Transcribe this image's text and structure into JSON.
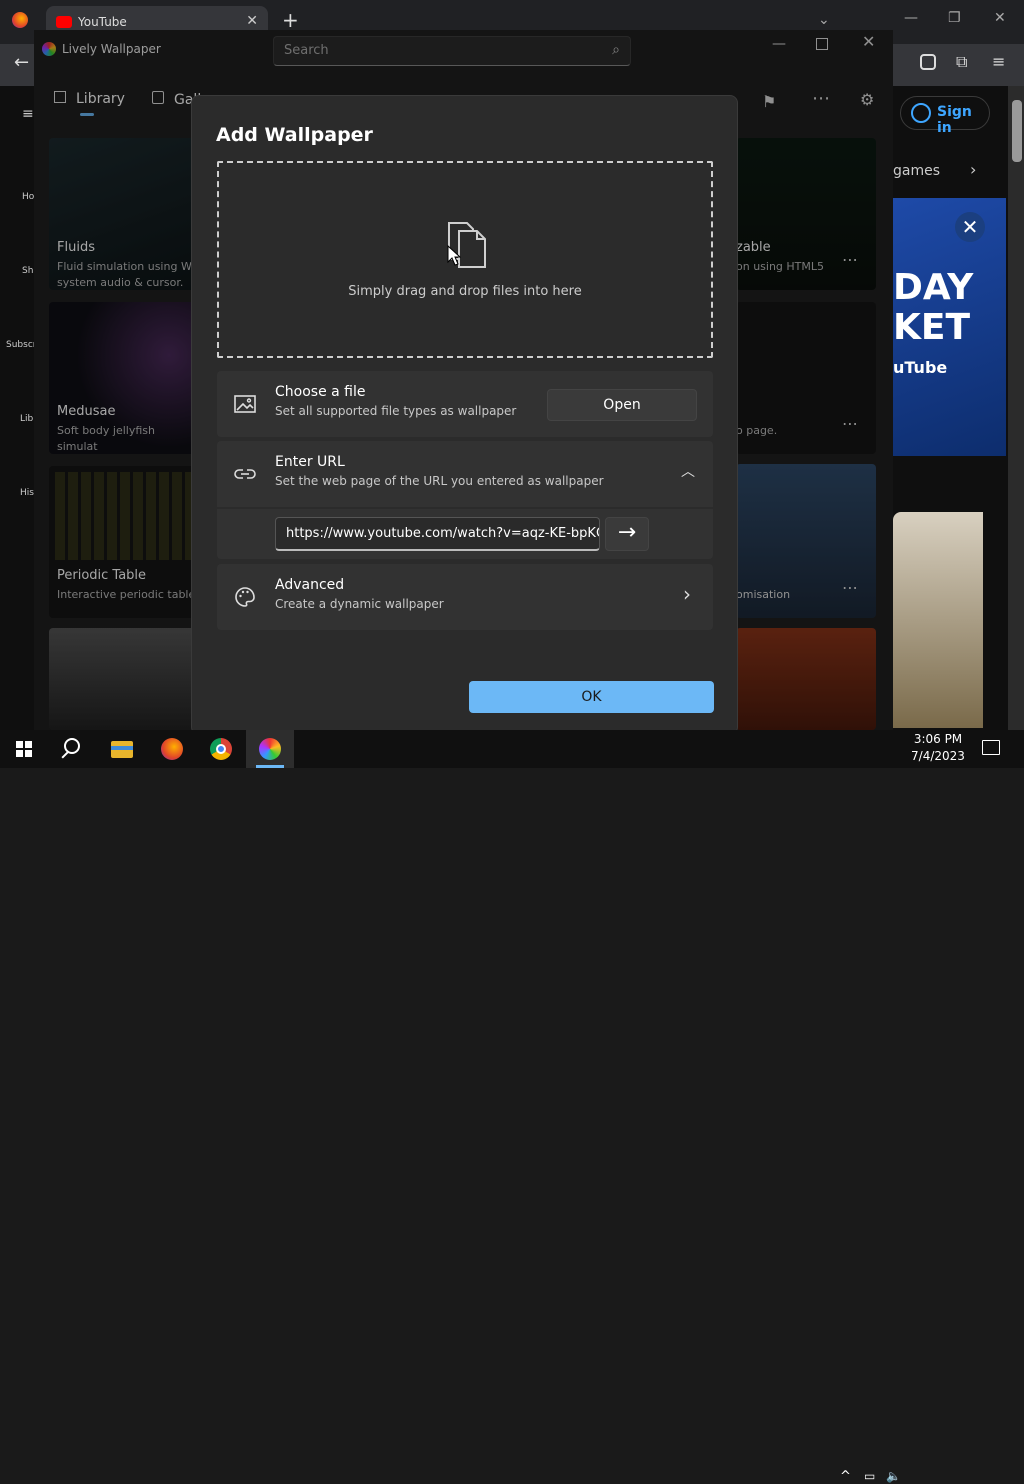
{
  "browser": {
    "tab_title": "YouTube",
    "sign_in": "Sign in",
    "chip": "games",
    "left_nav": [
      "Ho",
      "Sh",
      "Subscr",
      "Lib",
      "His"
    ],
    "ad_text": "DAY\nKET",
    "ad_sub": "uTube"
  },
  "lively": {
    "title": "Lively Wallpaper",
    "search_placeholder": "Search",
    "nav": {
      "library": "Library",
      "gallery": "Gall"
    },
    "cards": [
      {
        "title": "Fluids",
        "desc": "Fluid simulation using We\nsystem audio & cursor."
      },
      {
        "title": "Medusae",
        "desc": "Soft body jellyfish simulat"
      },
      {
        "title": "Periodic Table",
        "desc": "Interactive periodic table"
      },
      {
        "title": "zable",
        "desc": "on using HTML5"
      },
      {
        "title": "",
        "desc": "o page."
      },
      {
        "title": "",
        "desc": "omisation"
      }
    ]
  },
  "dialog": {
    "title": "Add Wallpaper",
    "drop_text": "Simply drag and drop files into here",
    "choose_file": {
      "title": "Choose a file",
      "desc": "Set all supported file types as wallpaper",
      "button": "Open"
    },
    "enter_url": {
      "title": "Enter URL",
      "desc": "Set the web page of the URL you entered as wallpaper",
      "value": "https://www.youtube.com/watch?v=aqz-KE-bpKQ"
    },
    "advanced": {
      "title": "Advanced",
      "desc": "Create a dynamic wallpaper"
    },
    "ok": "OK"
  },
  "taskbar": {
    "time": "3:06 PM",
    "date": "7/4/2023"
  },
  "colors": {
    "accent": "#6cb8f6",
    "youtube_red": "#ff0000"
  }
}
